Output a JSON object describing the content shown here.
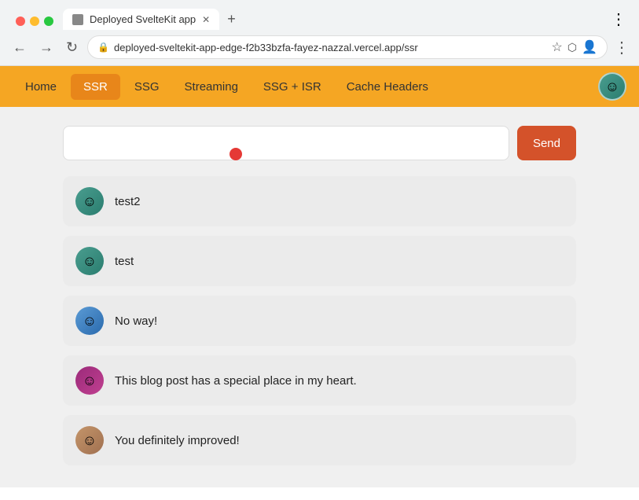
{
  "browser": {
    "tab_title": "Deployed SvelteKit app",
    "url": "deployed-sveltekit-app-edge-f2b33bzfa-fayez-nazzal.vercel.app/ssr",
    "new_tab_label": "+",
    "back_btn": "←",
    "forward_btn": "→",
    "refresh_btn": "↻"
  },
  "nav": {
    "items": [
      {
        "id": "home",
        "label": "Home",
        "active": false
      },
      {
        "id": "ssr",
        "label": "SSR",
        "active": true
      },
      {
        "id": "ssg",
        "label": "SSG",
        "active": false
      },
      {
        "id": "streaming",
        "label": "Streaming",
        "active": false
      },
      {
        "id": "ssg-isr",
        "label": "SSG + ISR",
        "active": false
      },
      {
        "id": "cache-headers",
        "label": "Cache Headers",
        "active": false
      }
    ]
  },
  "message_input": {
    "placeholder": "",
    "value": ""
  },
  "send_button": "Send",
  "messages": [
    {
      "id": 1,
      "text": "test2",
      "avatar_class": "avatar-1"
    },
    {
      "id": 2,
      "text": "test",
      "avatar_class": "avatar-1"
    },
    {
      "id": 3,
      "text": "No way!",
      "avatar_class": "avatar-2"
    },
    {
      "id": 4,
      "text": "This blog post has a special place in my heart.",
      "avatar_class": "avatar-4"
    },
    {
      "id": 5,
      "text": "You definitely improved!",
      "avatar_class": "avatar-5"
    }
  ],
  "face_emoji": "☺"
}
